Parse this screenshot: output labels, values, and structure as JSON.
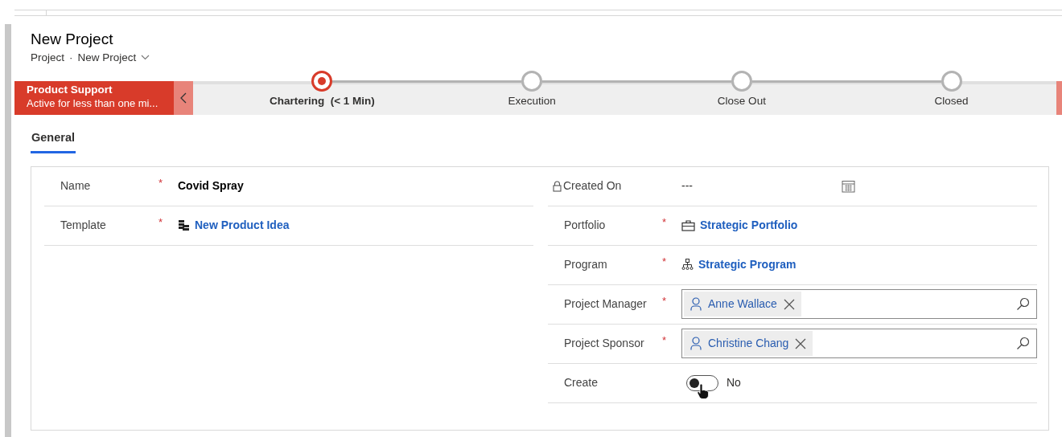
{
  "header": {
    "title": "New Project",
    "entity": "Project",
    "separator": "·",
    "form_name": "New Project"
  },
  "process": {
    "name": "Product Support",
    "status": "Active for less than one mi...",
    "stages": [
      {
        "label": "Chartering",
        "duration": "(< 1 Min)",
        "selected": true
      },
      {
        "label": "Execution",
        "selected": false
      },
      {
        "label": "Close Out",
        "selected": false
      },
      {
        "label": "Closed",
        "selected": false
      }
    ]
  },
  "tabs": [
    {
      "label": "General",
      "selected": true
    }
  ],
  "left_fields": [
    {
      "kind": "text",
      "label": "Name",
      "required_mark": "*",
      "value": "Covid Spray"
    },
    {
      "kind": "link",
      "label": "Template",
      "required_mark": "*",
      "value": "New Product Idea"
    }
  ],
  "right_fields": [
    {
      "kind": "date",
      "label": "Created On",
      "locked": true,
      "value": "---"
    },
    {
      "kind": "link",
      "label": "Portfolio",
      "required_mark": "*",
      "value": "Strategic Portfolio"
    },
    {
      "kind": "link",
      "label": "Program",
      "required_mark": "*",
      "value": "Strategic Program"
    },
    {
      "kind": "person",
      "label": "Project Manager",
      "required_mark": "*",
      "value": "Anne Wallace"
    },
    {
      "kind": "person",
      "label": "Project Sponsor",
      "required_mark": "*",
      "value": "Christine Chang"
    },
    {
      "kind": "toggle",
      "label": "Create",
      "on": false,
      "value": "No"
    }
  ]
}
